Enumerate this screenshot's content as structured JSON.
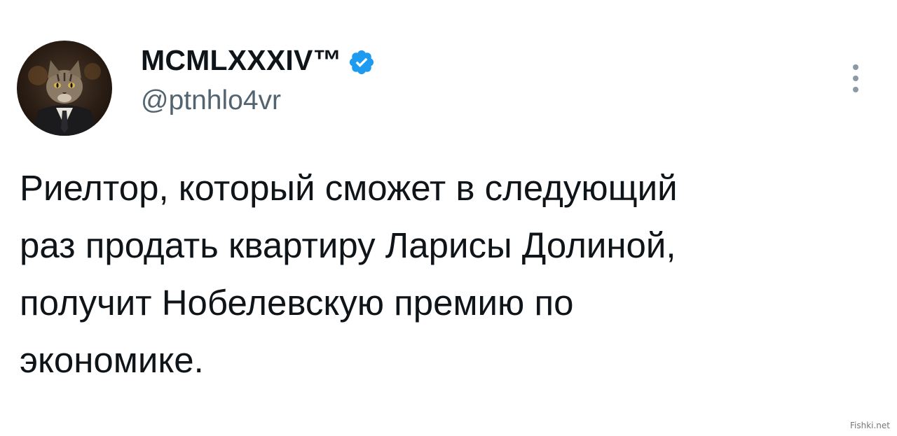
{
  "author": {
    "display_name": "MCMLXXXIV™",
    "handle": "@ptnhlo4vr",
    "avatar_icon": "cat-in-suit-avatar",
    "verified_icon": "verified-badge-icon",
    "verified_color": "#1d9bf0"
  },
  "tweet": {
    "lines": [
      "Риелтор, который сможет в следующий",
      "раз продать квартиру Ларисы Долиной,",
      "получит Нобелевскую премию по",
      "экономике."
    ]
  },
  "menu": {
    "icon": "more-vertical-icon"
  },
  "watermark": {
    "text": "Fishki.net"
  }
}
